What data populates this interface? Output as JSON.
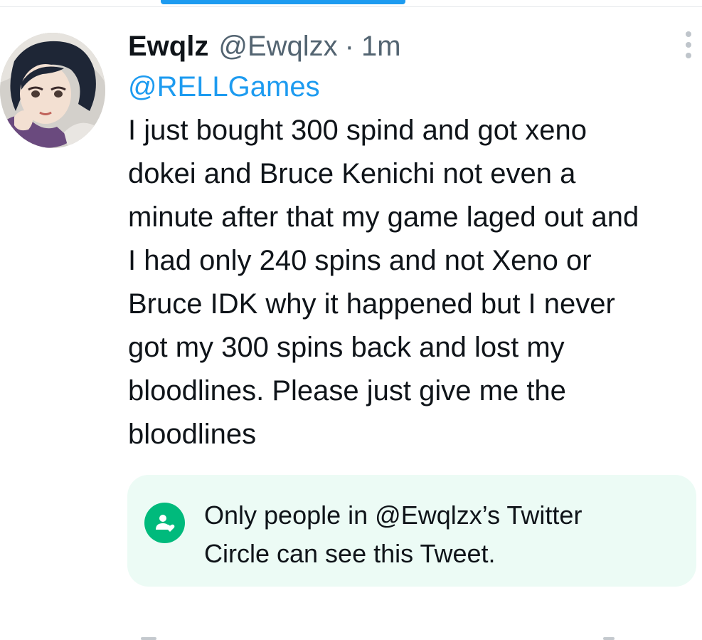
{
  "tweet": {
    "display_name": "Ewqlz",
    "handle": "@Ewqlzx",
    "separator": "·",
    "time": "1m",
    "reply_to": "@RELLGames",
    "text_lines": [
      "I just bought 300 spind and got xeno",
      "dokei and Bruce Kenichi not even a",
      "minute after that my game laged out and",
      "I had only 240 spins and not Xeno or",
      "Bruce IDK why it happened but I never",
      "got my 300 spins back and lost my",
      "bloodlines. Please just give me the",
      "bloodlines"
    ]
  },
  "circle_notice": {
    "lines": [
      "Only people in @Ewqlzx’s Twitter",
      "Circle can see this Tweet."
    ],
    "icon": "twitter-circle-icon"
  },
  "icons": {
    "more": "more-vertical-icon",
    "avatar": "avatar"
  },
  "colors": {
    "accent": "#1d9bf0",
    "circle_green": "#00ba7c",
    "circle_background": "#ecfbf5",
    "secondary_text": "#536471"
  }
}
